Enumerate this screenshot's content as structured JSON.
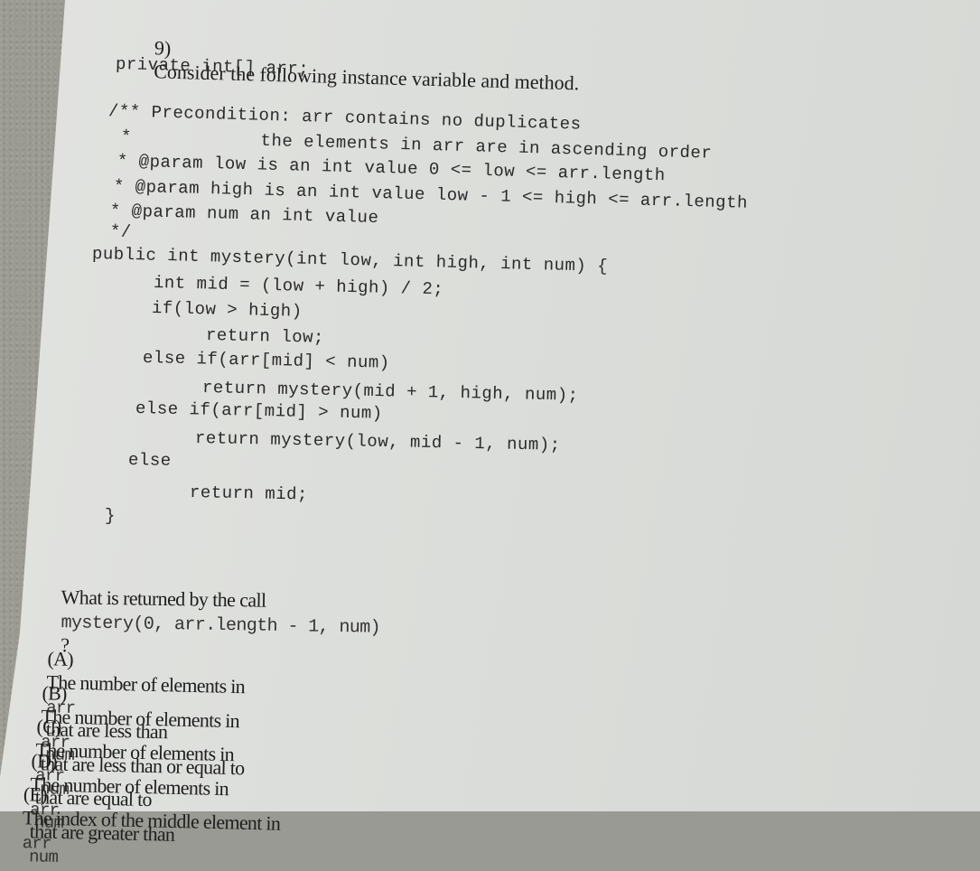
{
  "question": {
    "number": "9)",
    "intro": "Consider the following instance variable and method."
  },
  "code": {
    "field": "private int[] arr;",
    "comment": [
      "/** Precondition: arr contains no duplicates",
      " *            the elements in arr are in ascending order",
      " * @param low is an int value 0 <= low <= arr.length",
      " * @param high is an int value low - 1 <= high <= arr.length",
      " * @param num an int value",
      " */"
    ],
    "method": [
      "public int mystery(int low, int high, int num) {",
      "int mid = (low + high) / 2;",
      "if(low > high)",
      "return low;",
      "else if(arr[mid] < num)",
      "return mystery(mid + 1, high, num);",
      "else if(arr[mid] > num)",
      "return mystery(low, mid - 1, num);",
      "else",
      "return mid;",
      "}"
    ]
  },
  "prompt": {
    "text": "What is returned by the call",
    "call": "mystery(0, arr.length - 1, num)",
    "suffix": "?"
  },
  "options": [
    {
      "label": "(A)",
      "pre": "The number of elements in",
      "code1": "arr",
      "post": "that are less than",
      "code2": "num"
    },
    {
      "label": "(B)",
      "pre": "The number of elements in",
      "code1": "arr",
      "post": "that are less than or equal to",
      "code2": "num"
    },
    {
      "label": "(C)",
      "pre": "The number of elements in",
      "code1": "arr",
      "post": "that are equal to",
      "code2": "num"
    },
    {
      "label": "(D)",
      "pre": "The number of elements in",
      "code1": "arr",
      "post": "that are greater than",
      "code2": "num"
    },
    {
      "label": "(E)",
      "pre": "The index of the middle element in",
      "code1": "arr",
      "post": "",
      "code2": ""
    }
  ]
}
